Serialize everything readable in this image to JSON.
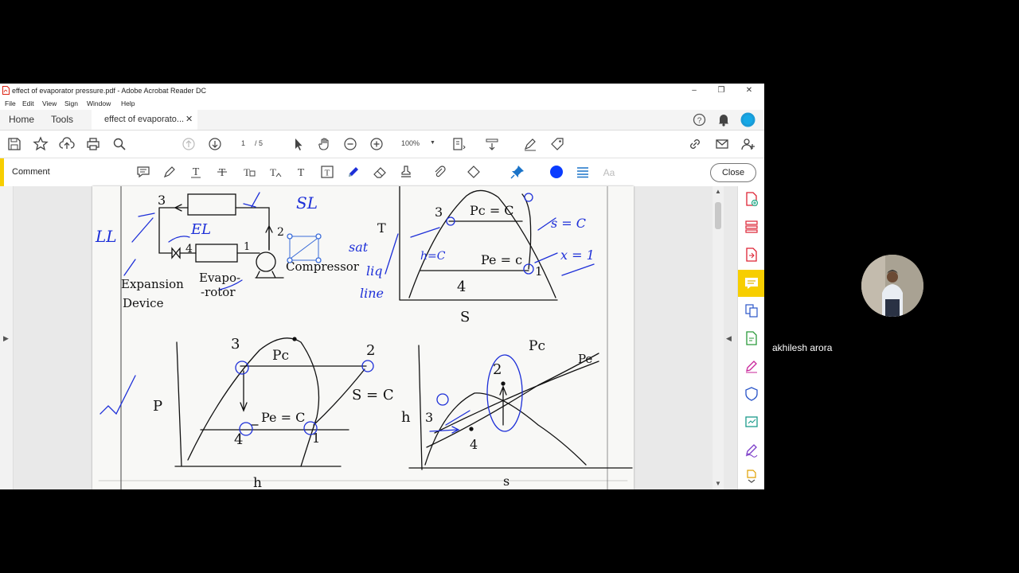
{
  "window": {
    "title": "effect of evaporator pressure.pdf - Adobe Acrobat Reader DC"
  },
  "menu": [
    "File",
    "Edit",
    "View",
    "Sign",
    "Window",
    "Help"
  ],
  "tabs": {
    "home": "Home",
    "tools": "Tools",
    "document": "effect of evaporato..."
  },
  "toolbar": {
    "page_current": "1",
    "page_total": "/ 5",
    "zoom": "100%"
  },
  "comment_bar": {
    "label": "Comment",
    "close_label": "Close",
    "active_color": "#0a3cff"
  },
  "video": {
    "participant_name": "akhilesh arora"
  },
  "colors": {
    "accent": "#f7ce00",
    "pen": "#1d2fd8",
    "brand": "#1a9bd7"
  },
  "sketch": {
    "cycle": {
      "n3": "3",
      "n4": "4",
      "n1": "1",
      "n2": "2",
      "expansion_1": "Expansion",
      "expansion_2": "Device",
      "evap_1": "Evapo-",
      "evap_2": "-rotor",
      "compressor": "Compressor",
      "ll": "LL",
      "el": "EL",
      "sl": "SL"
    },
    "ts": {
      "T": "T",
      "S": "S",
      "n3": "3",
      "n4": "4",
      "n1": "1",
      "pc": "Pc = C",
      "pe": "Pe = c",
      "sc": "s = C",
      "x1": "x = 1",
      "sat1": "sat",
      "sat2": "liq",
      "sat3": "line",
      "hc": "h=C"
    },
    "ph": {
      "P": "P",
      "h": "h",
      "n1": "1",
      "n2": "2",
      "n3": "3",
      "n4": "4",
      "pc": "Pc",
      "pe": "Pe = C",
      "sc": "S = C"
    },
    "hs": {
      "h": "h",
      "s": "s",
      "n2": "2",
      "n3": "3",
      "n4": "4",
      "pc": "Pc",
      "pe": "Pe"
    }
  }
}
